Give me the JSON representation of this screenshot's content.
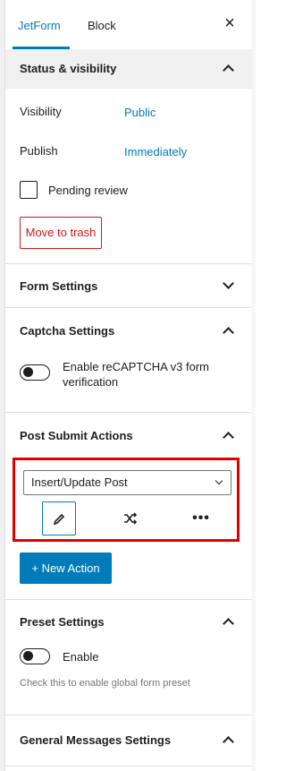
{
  "tabs": [
    {
      "label": "JetForm",
      "active": true
    },
    {
      "label": "Block",
      "active": false
    }
  ],
  "close_icon": "×",
  "status_panel": {
    "title": "Status & visibility",
    "visibility_label": "Visibility",
    "visibility_value": "Public",
    "publish_label": "Publish",
    "publish_value": "Immediately",
    "pending_label": "Pending review",
    "trash_label": "Move to trash"
  },
  "form_settings": {
    "title": "Form Settings"
  },
  "captcha_settings": {
    "title": "Captcha Settings",
    "toggle_label_line1": "Enable reCAPTCHA v3 form",
    "toggle_label_line2": "verification"
  },
  "post_submit": {
    "title": "Post Submit Actions",
    "selected_action": "Insert/Update Post",
    "new_action_label": "+ New Action",
    "action_icons": [
      "pencil-icon",
      "shuffle-icon",
      "more-icon"
    ]
  },
  "preset_settings": {
    "title": "Preset Settings",
    "toggle_label": "Enable",
    "help_text": "Check this to enable global form preset"
  },
  "general_messages": {
    "title": "General Messages Settings"
  },
  "colors": {
    "accent": "#007cba",
    "danger": "#cc1818",
    "highlight": "#e00000"
  }
}
